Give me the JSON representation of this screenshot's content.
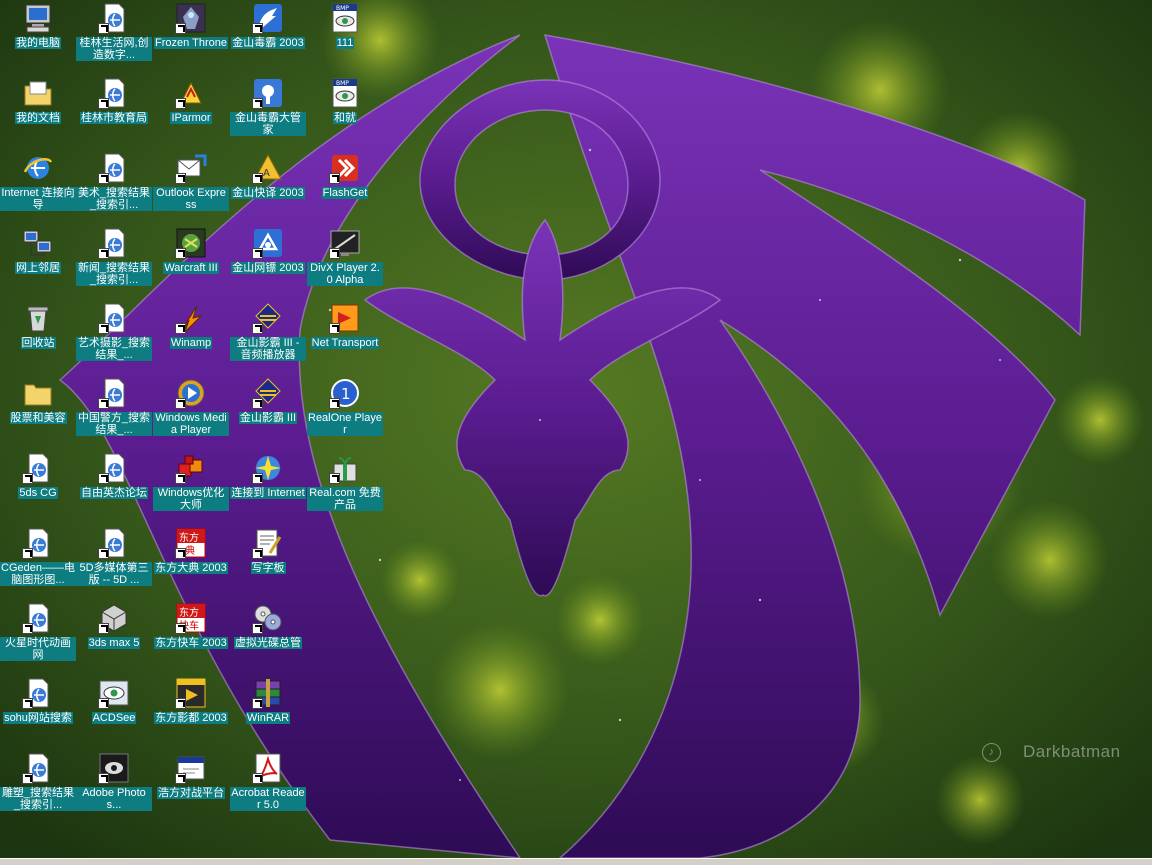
{
  "watermark": {
    "text": "Darkbatman"
  },
  "icons": [
    {
      "id": "my-computer",
      "label": "我的电脑",
      "icon": "computer-icon",
      "shortcut": false
    },
    {
      "id": "guilin-life",
      "label": "桂林生活网,创造数字...",
      "icon": "ie-page-icon",
      "shortcut": true
    },
    {
      "id": "frozen-throne",
      "label": "Frozen Throne",
      "icon": "frozen-throne-icon",
      "shortcut": true
    },
    {
      "id": "jinshan-duba",
      "label": "金山毒霸 2003",
      "icon": "jinshan-duba-icon",
      "shortcut": true
    },
    {
      "id": "file-111",
      "label": "111",
      "icon": "bmp-eye-icon",
      "shortcut": false
    },
    {
      "id": "my-documents",
      "label": "我的文档",
      "icon": "folder-documents-icon",
      "shortcut": false
    },
    {
      "id": "guilin-edu",
      "label": "桂林市教育局",
      "icon": "ie-page-icon",
      "shortcut": true
    },
    {
      "id": "iparmor",
      "label": "IParmor",
      "icon": "iparmor-icon",
      "shortcut": true
    },
    {
      "id": "duba-manager",
      "label": "金山毒霸大管家",
      "icon": "duba-manager-icon",
      "shortcut": true
    },
    {
      "id": "hejiu",
      "label": "和就",
      "icon": "bmp-eye-icon",
      "shortcut": false
    },
    {
      "id": "internet-wizard",
      "label": "Internet 连接向导",
      "icon": "internet-explorer-icon",
      "shortcut": false
    },
    {
      "id": "meishu-search",
      "label": "美术_搜索结果_搜索引...",
      "icon": "ie-page-icon",
      "shortcut": true
    },
    {
      "id": "outlook-express",
      "label": "Outlook Express",
      "icon": "outlook-express-icon",
      "shortcut": true
    },
    {
      "id": "jinshan-kuaiyi",
      "label": "金山快译 2003",
      "icon": "kuaiyi-icon",
      "shortcut": true
    },
    {
      "id": "flashget",
      "label": "FlashGet",
      "icon": "flashget-icon",
      "shortcut": true
    },
    {
      "id": "network-places",
      "label": "网上邻居",
      "icon": "network-icon",
      "shortcut": false
    },
    {
      "id": "news-search",
      "label": "新闻_搜索结果_搜索引...",
      "icon": "ie-page-icon",
      "shortcut": true
    },
    {
      "id": "warcraft3",
      "label": "Warcraft III",
      "icon": "warcraft-icon",
      "shortcut": true
    },
    {
      "id": "jinshan-wangbiao",
      "label": "金山网镖 2003",
      "icon": "wangbiao-icon",
      "shortcut": true
    },
    {
      "id": "divx-player",
      "label": "DivX Player 2.0 Alpha",
      "icon": "divx-icon",
      "shortcut": true
    },
    {
      "id": "recycle-bin",
      "label": "回收站",
      "icon": "recycle-bin-icon",
      "shortcut": false
    },
    {
      "id": "art-photo-search",
      "label": "艺术摄影_搜索结果_...",
      "icon": "ie-page-icon",
      "shortcut": true
    },
    {
      "id": "winamp",
      "label": "Winamp",
      "icon": "winamp-icon",
      "shortcut": true
    },
    {
      "id": "jinshan-yingba-audio",
      "label": "金山影霸 III - 音频播放器",
      "icon": "yingba-icon",
      "shortcut": true
    },
    {
      "id": "net-transport",
      "label": "Net Transport",
      "icon": "net-transport-icon",
      "shortcut": true
    },
    {
      "id": "stocks-beauty",
      "label": "股票和美容",
      "icon": "folder-icon",
      "shortcut": false
    },
    {
      "id": "china-police-search",
      "label": "中国警方_搜索结果_...",
      "icon": "ie-page-icon",
      "shortcut": true
    },
    {
      "id": "wmp",
      "label": "Windows Media Player",
      "icon": "media-player-icon",
      "shortcut": true
    },
    {
      "id": "jinshan-yingba",
      "label": "金山影霸 III",
      "icon": "yingba-icon",
      "shortcut": true
    },
    {
      "id": "realone",
      "label": "RealOne Player",
      "icon": "realone-icon",
      "shortcut": true
    },
    {
      "id": "5ds-cg",
      "label": "5ds CG",
      "icon": "ie-page-icon",
      "shortcut": true
    },
    {
      "id": "free-hero",
      "label": "自由英杰论坛",
      "icon": "ie-page-icon",
      "shortcut": true
    },
    {
      "id": "windows-optimizer",
      "label": "Windows优化大师",
      "icon": "optimizer-icon",
      "shortcut": true
    },
    {
      "id": "connect-internet",
      "label": "连接到 Internet",
      "icon": "connect-icon",
      "shortcut": true
    },
    {
      "id": "real-free",
      "label": "Real.com 免费产品",
      "icon": "gift-icon",
      "shortcut": true
    },
    {
      "id": "cgeden",
      "label": "CGeden——电脑图形图...",
      "icon": "ie-page-icon",
      "shortcut": true
    },
    {
      "id": "5d-multimedia",
      "label": "5D多媒体第三版 -- 5D ...",
      "icon": "ie-page-icon",
      "shortcut": true
    },
    {
      "id": "dongfang-dadian",
      "label": "东方大典 2003",
      "icon": "dongfang-dadian-icon",
      "shortcut": true
    },
    {
      "id": "wordpad",
      "label": "写字板",
      "icon": "wordpad-icon",
      "shortcut": true
    },
    {
      "id": "mars-animation",
      "label": "火星时代动画网",
      "icon": "ie-page-icon",
      "shortcut": true
    },
    {
      "id": "3dsmax",
      "label": "3ds max 5",
      "icon": "3dsmax-icon",
      "shortcut": true
    },
    {
      "id": "dongfang-kuaiche",
      "label": "东方快车 2003",
      "icon": "kuaiche-icon",
      "shortcut": true
    },
    {
      "id": "virtual-cd",
      "label": "虚拟光碟总管",
      "icon": "virtual-cd-icon",
      "shortcut": true
    },
    {
      "id": "sohu-search",
      "label": "sohu网站搜索",
      "icon": "ie-page-icon",
      "shortcut": true
    },
    {
      "id": "acdsee",
      "label": "ACDSee",
      "icon": "acdsee-icon",
      "shortcut": true
    },
    {
      "id": "dongfang-yingdu",
      "label": "东方影都 2003",
      "icon": "yingdu-icon",
      "shortcut": true
    },
    {
      "id": "winrar",
      "label": "WinRAR",
      "icon": "winrar-icon",
      "shortcut": true
    },
    {
      "id": "sculpture-search",
      "label": "雕塑_搜索结果_搜索引...",
      "icon": "ie-page-icon",
      "shortcut": true
    },
    {
      "id": "photoshop",
      "label": "Adobe Photos...",
      "icon": "photoshop-icon",
      "shortcut": true
    },
    {
      "id": "haofang",
      "label": "浩方对战平台",
      "icon": "haofang-icon",
      "shortcut": true
    },
    {
      "id": "acrobat",
      "label": "Acrobat Reader 5.0",
      "icon": "acrobat-icon",
      "shortcut": true
    }
  ]
}
